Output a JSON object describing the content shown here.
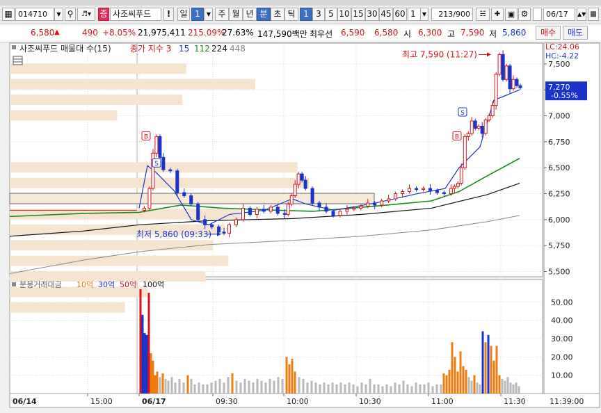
{
  "toolbar": {
    "code": "014710",
    "stock_name": "사조씨푸드",
    "stock_badge": "증",
    "exclaim": "!",
    "periods": [
      "일",
      "주",
      "월",
      "년",
      "분",
      "초",
      "틱"
    ],
    "period_num_label": "1",
    "intervals": [
      "1",
      "3",
      "5",
      "10",
      "15",
      "30",
      "45",
      "60"
    ],
    "interval_value": "1",
    "count": "213/900",
    "date": "06/17"
  },
  "quote": {
    "price": "6,580",
    "change": "490",
    "change_pct": "+8.05%",
    "volume": "21,975,411",
    "vol_ratio": "215.09%",
    "turnover": "27.63%",
    "amount": "147,590백만",
    "best_sell_label": "최우선",
    "best_sell": "6,590",
    "best_buy": "6,580",
    "open_label": "시",
    "open": "6,300",
    "high_label": "고",
    "high": "7,590",
    "low_label": "저",
    "low": "5,860",
    "buy_button": "매수",
    "sell_button": "매도"
  },
  "colors": {
    "up": "#d3141e",
    "down": "#1a33c8",
    "ma15": "#1a33c8",
    "ma112": "#1b8a1b",
    "ma224": "#111111",
    "ma448": "#888888",
    "profile": "#f5e4cf",
    "vol10": "#f07c12",
    "vol30": "#1a33c8",
    "vol50": "#d3141e",
    "vol100": "#111111",
    "volgrey": "#b9b9b9"
  },
  "chart_data": [
    {
      "type": "candlestick",
      "legend_title": "사조씨푸드 매물대 수(15)",
      "ma_legend_title": "종가 지수 3",
      "ma_periods": [
        "15",
        "112",
        "224",
        "448"
      ],
      "y_ticks": [
        "7,500",
        "7,250",
        "7,000",
        "6,750",
        "6,500",
        "6,250",
        "6,000",
        "5,750",
        "5,500"
      ],
      "ylim": [
        5450,
        7700
      ],
      "lc_label": "LC:24.06",
      "hc_label": "HC:-4.22",
      "current_price": "7,270",
      "current_pct": "-0.55%",
      "high_note": "최고 7,590 (11:27)",
      "low_note": "최저 5,860 (09:33)",
      "volume_profile_rel": [
        0.46,
        0.64,
        0.45,
        0.28,
        0.0,
        0.75,
        0.78,
        0.95,
        0.6,
        0.56,
        0.53,
        0.57,
        0.51,
        0.36,
        0.3
      ],
      "series_path_points": [
        [
          0,
          6090
        ],
        [
          3,
          6110
        ],
        [
          6,
          6300
        ],
        [
          8,
          6640
        ],
        [
          10,
          6800
        ],
        [
          12,
          6600
        ],
        [
          14,
          6480
        ],
        [
          18,
          6470
        ],
        [
          22,
          6260
        ],
        [
          26,
          6230
        ],
        [
          30,
          6150
        ],
        [
          34,
          6000
        ],
        [
          38,
          5950
        ],
        [
          42,
          5930
        ],
        [
          46,
          5880
        ],
        [
          49,
          5870
        ],
        [
          52,
          5950
        ],
        [
          56,
          6000
        ],
        [
          60,
          6110
        ],
        [
          64,
          6050
        ],
        [
          68,
          6100
        ],
        [
          72,
          6080
        ],
        [
          76,
          6120
        ],
        [
          80,
          6060
        ],
        [
          84,
          6050
        ],
        [
          86,
          6150
        ],
        [
          88,
          6230
        ],
        [
          90,
          6340
        ],
        [
          92,
          6440
        ],
        [
          94,
          6380
        ],
        [
          96,
          6300
        ],
        [
          100,
          6160
        ],
        [
          104,
          6120
        ],
        [
          108,
          6080
        ],
        [
          112,
          6040
        ],
        [
          116,
          6080
        ],
        [
          120,
          6100
        ],
        [
          124,
          6110
        ],
        [
          128,
          6130
        ],
        [
          132,
          6160
        ],
        [
          136,
          6140
        ],
        [
          140,
          6180
        ],
        [
          144,
          6200
        ],
        [
          148,
          6250
        ],
        [
          152,
          6270
        ],
        [
          156,
          6300
        ],
        [
          160,
          6290
        ],
        [
          164,
          6300
        ],
        [
          168,
          6280
        ],
        [
          172,
          6260
        ],
        [
          176,
          6250
        ],
        [
          180,
          6300
        ],
        [
          182,
          6320
        ],
        [
          184,
          6350
        ],
        [
          186,
          6500
        ],
        [
          188,
          6800
        ],
        [
          190,
          6830
        ],
        [
          192,
          6950
        ],
        [
          194,
          6880
        ],
        [
          196,
          6900
        ],
        [
          198,
          6830
        ],
        [
          200,
          6960
        ],
        [
          202,
          7000
        ],
        [
          204,
          7100
        ],
        [
          206,
          7400
        ],
        [
          208,
          7590
        ],
        [
          210,
          7350
        ],
        [
          212,
          7480
        ],
        [
          214,
          7260
        ],
        [
          216,
          7350
        ],
        [
          218,
          7290
        ],
        [
          220,
          7270
        ]
      ],
      "annotations_markers": [
        "B",
        "S",
        "S",
        "B"
      ]
    },
    {
      "type": "bar",
      "legend_title": "분봉거래대금",
      "legend_items": [
        "10억",
        "30억",
        "50억",
        "100억"
      ],
      "y_ticks": [
        "50.00",
        "40.00",
        "30.00",
        "20.00",
        "10.00"
      ],
      "ylim": [
        0,
        60
      ],
      "x_ticks": [
        "06/14",
        "15:00",
        "06/17",
        "09:30",
        "10:00",
        "10:30",
        "11:00",
        "11:30",
        "11:39:00"
      ]
    }
  ]
}
